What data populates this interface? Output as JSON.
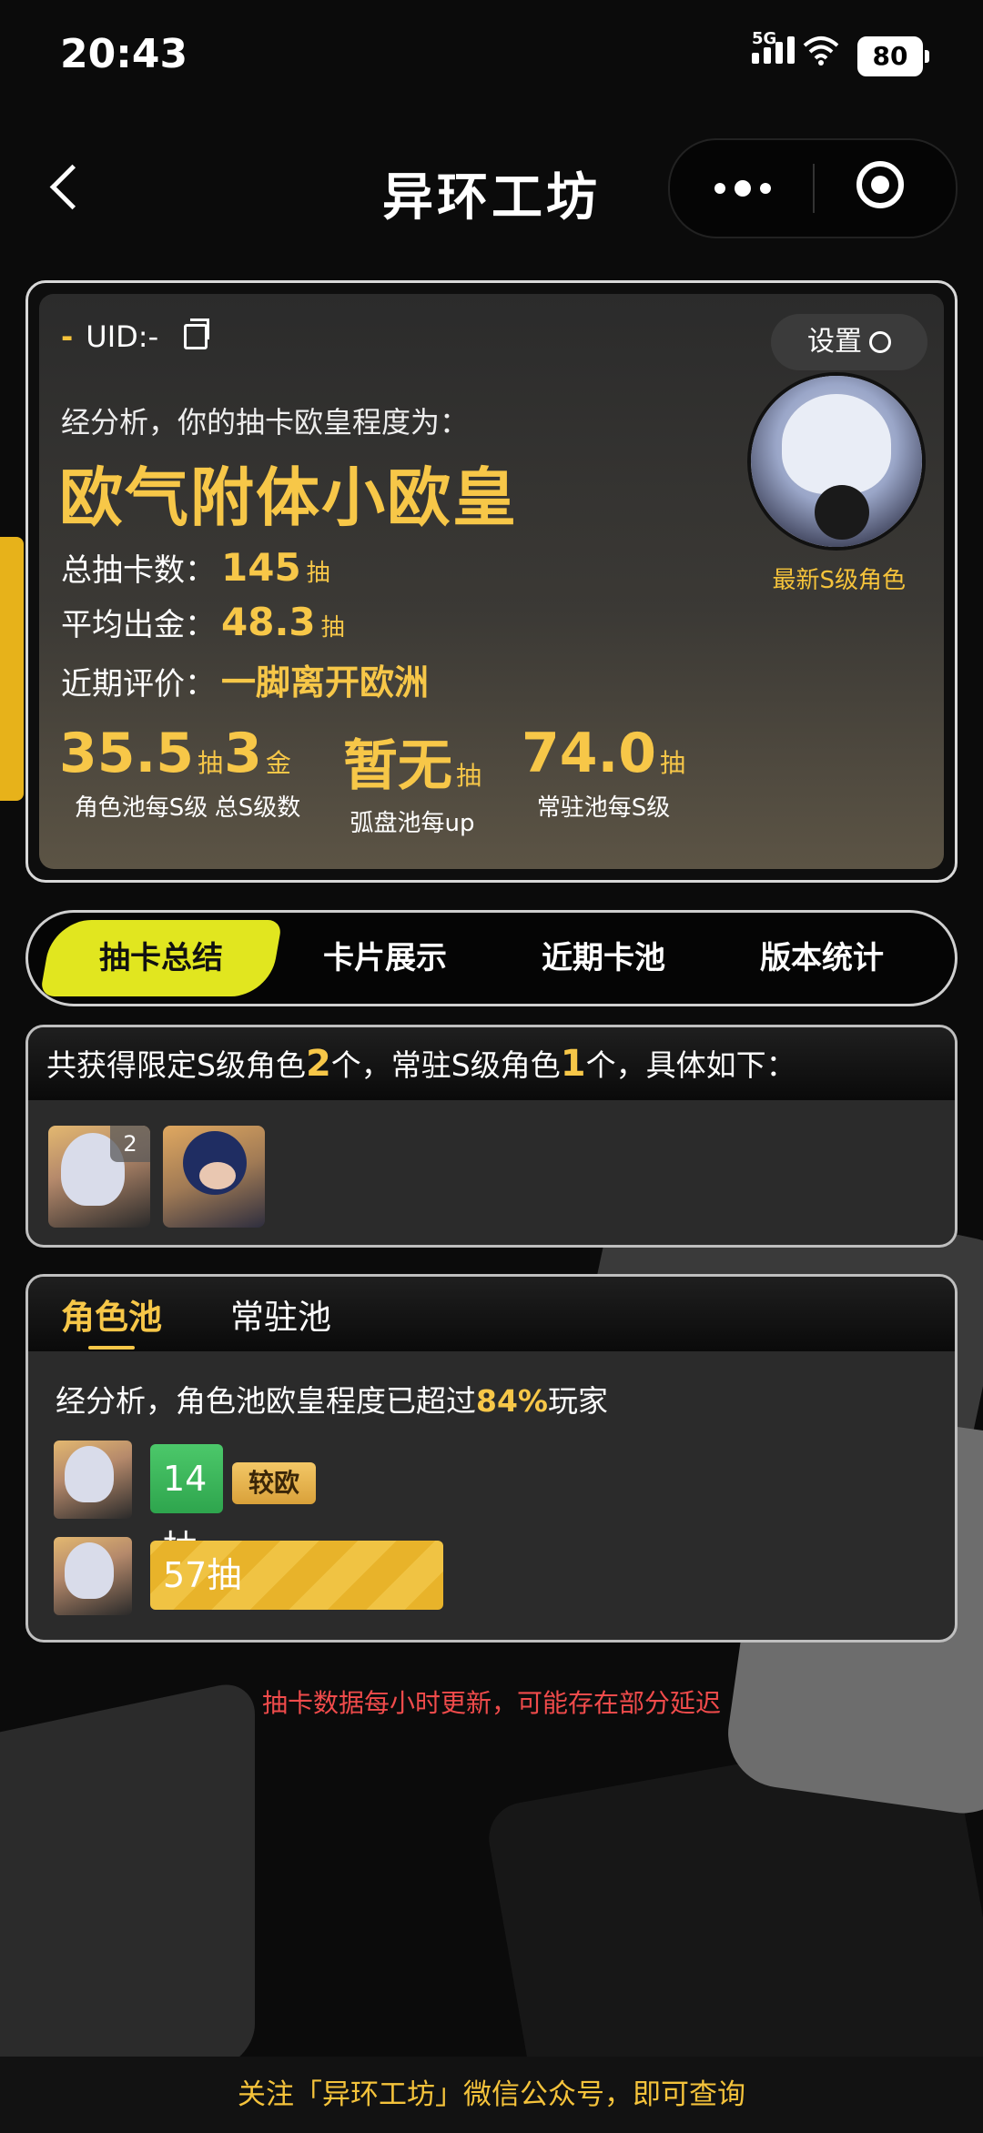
{
  "status_bar": {
    "time": "20:43",
    "network": "5G",
    "battery": "80"
  },
  "nav": {
    "title": "异环工坊"
  },
  "profile": {
    "uid_dash": "-",
    "uid_label": "UID:-",
    "settings_label": "设置",
    "analysis_intro": "经分析，你的抽卡欧皇程度为：",
    "rank_title": "欧气附体小欧皇",
    "stats": [
      {
        "label": "总抽卡数：",
        "value": "145",
        "unit": "抽"
      },
      {
        "label": "平均出金：",
        "value": "48.3",
        "unit": "抽"
      },
      {
        "label": "近期评价：",
        "value": "一脚离开欧洲",
        "unit": ""
      }
    ],
    "avatar_caption": "最新S级角色",
    "metrics": [
      {
        "value": "35.5",
        "unit": "抽",
        "label": "角色池每S级"
      },
      {
        "value": "3",
        "unit": "金",
        "label": "总S级数"
      },
      {
        "value": "暂无",
        "unit": "抽",
        "label": "弧盘池每up"
      },
      {
        "value": "74.0",
        "unit": "抽",
        "label": "常驻池每S级"
      }
    ]
  },
  "tabs": [
    {
      "label": "抽卡总结",
      "active": true
    },
    {
      "label": "卡片展示",
      "active": false
    },
    {
      "label": "近期卡池",
      "active": false
    },
    {
      "label": "版本统计",
      "active": false
    }
  ],
  "owned": {
    "text_1": "共获得限定S级角色",
    "limited_count": "2",
    "text_2": "个，常驻S级角色",
    "standard_count": "1",
    "text_3": "个，具体如下：",
    "characters": [
      {
        "badge": "2"
      },
      {
        "badge": ""
      }
    ]
  },
  "pool": {
    "tabs": [
      {
        "label": "角色池",
        "active": true
      },
      {
        "label": "常驻池",
        "active": false
      }
    ],
    "desc_1": "经分析，角色池欧皇程度已超过",
    "percent": "84%",
    "desc_2": "玩家",
    "rows": [
      {
        "pulls": "14抽",
        "pulls_value": 14,
        "tag": "较欧"
      },
      {
        "pulls": "57抽",
        "pulls_value": 57,
        "tag": ""
      }
    ]
  },
  "notice": "抽卡数据每小时更新，可能存在部分延迟",
  "footer": "关注「异环工坊」微信公众号，即可查询",
  "colors": {
    "accent_gold": "#f7c748",
    "tab_active": "#e1e61f",
    "notice_red": "#f04b4b",
    "bar_green": "#3cb85c",
    "bar_gold": "#e8b32a"
  }
}
